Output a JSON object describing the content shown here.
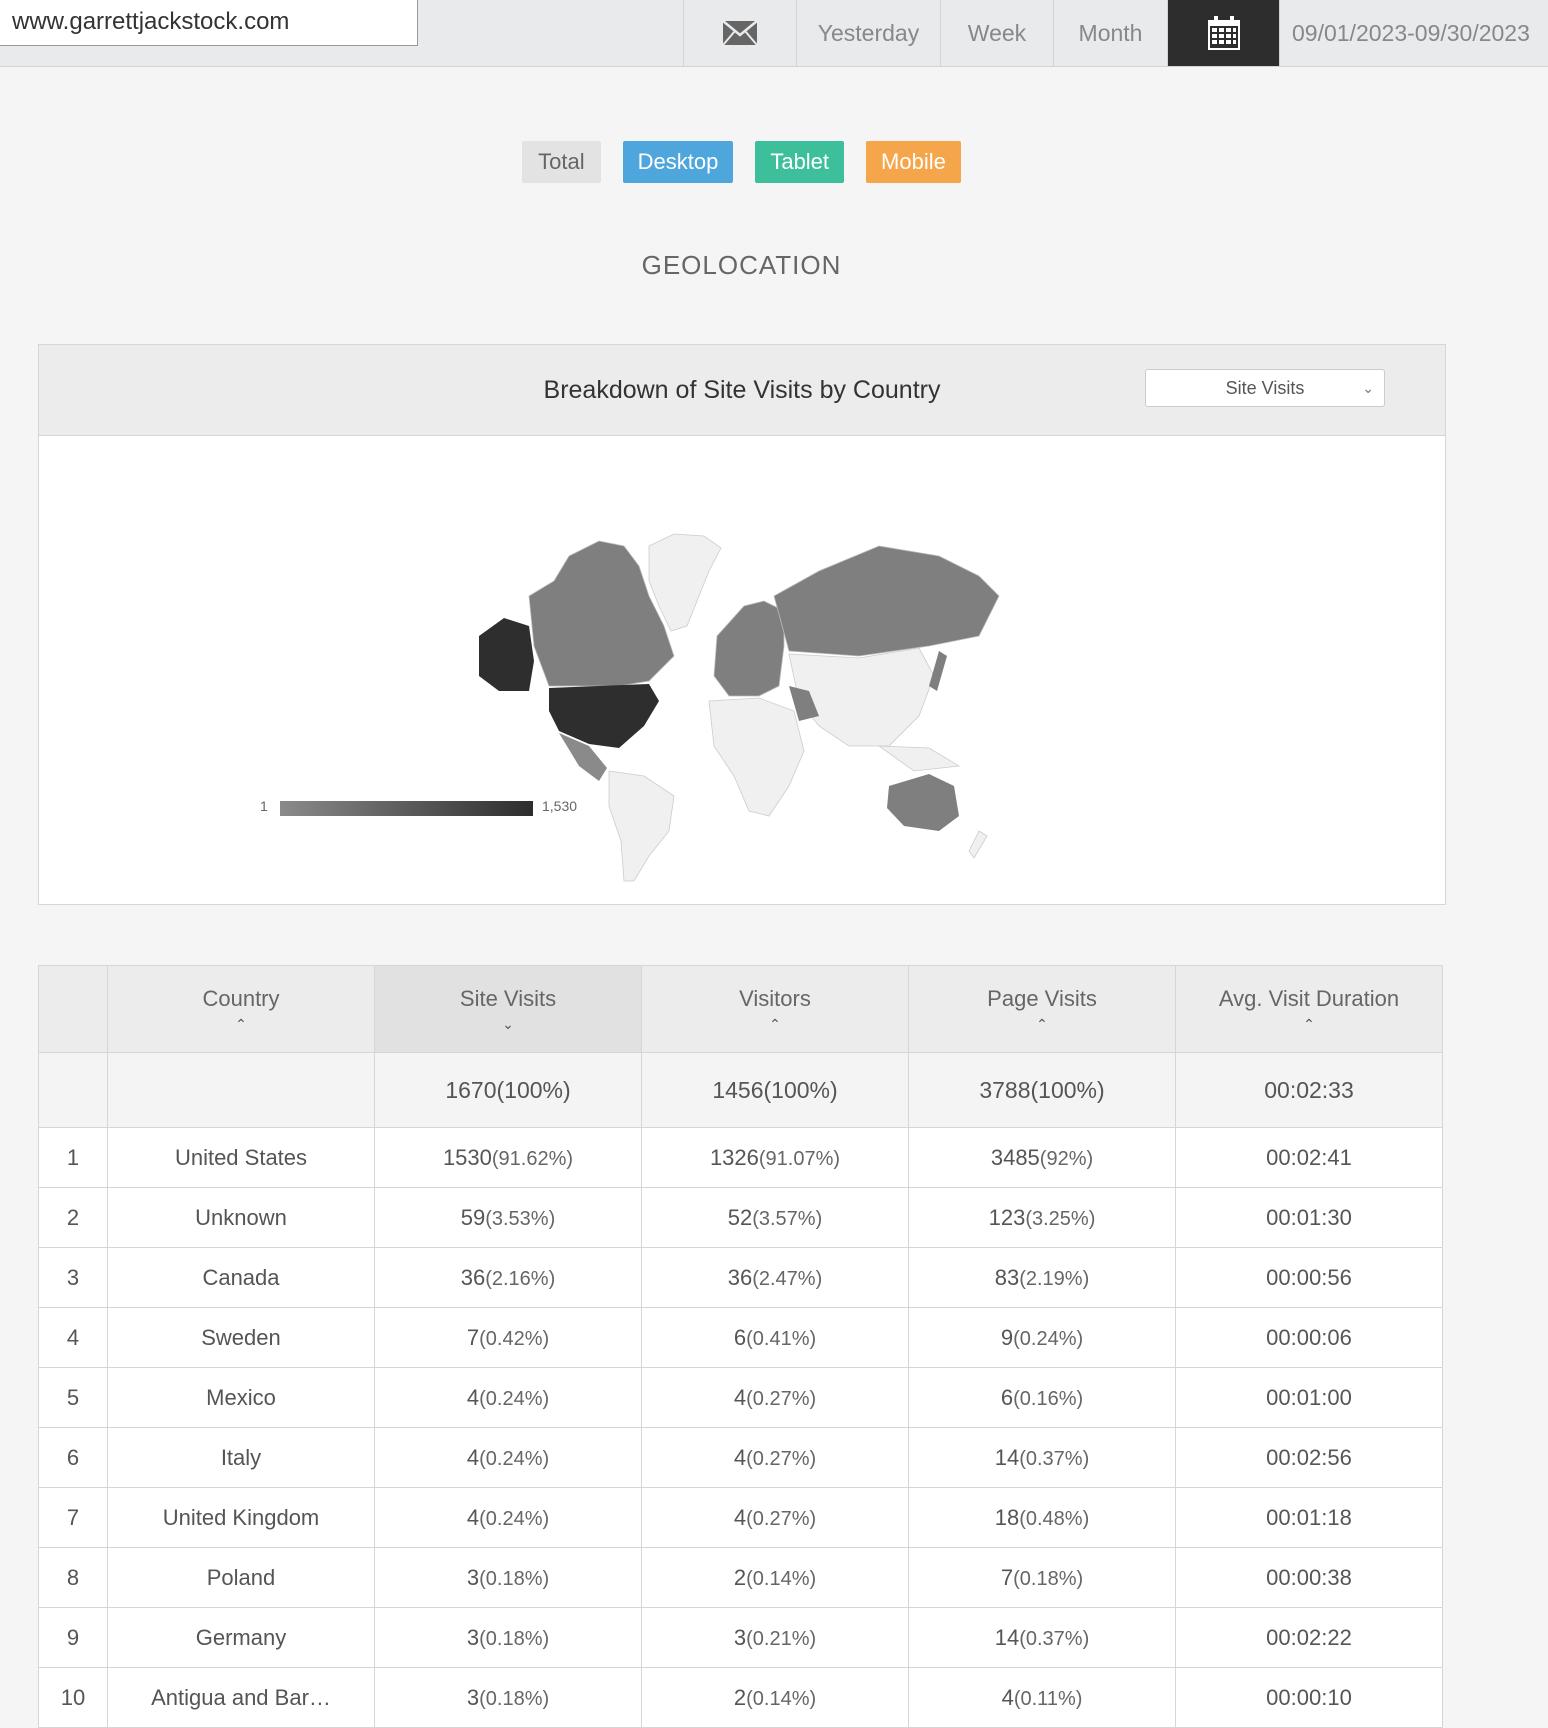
{
  "header": {
    "site": "www.garrettjackstock.com",
    "icons": {
      "mail": "mail-icon",
      "calendar": "calendar-icon"
    },
    "periods": [
      "Yesterday",
      "Week",
      "Month"
    ],
    "date_range": "09/01/2023-09/30/2023"
  },
  "filters": {
    "total": "Total",
    "desktop": "Desktop",
    "tablet": "Tablet",
    "mobile": "Mobile",
    "colors": {
      "desktop": "#4ea6dc",
      "tablet": "#3dbf9c",
      "mobile": "#f5a64a"
    }
  },
  "section_title": "GEOLOCATION",
  "map": {
    "title": "Breakdown of Site Visits by Country",
    "metric_selected": "Site Visits",
    "legend_min": "1",
    "legend_max": "1,530"
  },
  "table": {
    "columns": {
      "country": "Country",
      "site_visits": "Site Visits",
      "visitors": "Visitors",
      "page_visits": "Page Visits",
      "duration": "Avg. Visit Duration"
    },
    "totals": {
      "site_visits": "1670(100%)",
      "visitors": "1456(100%)",
      "page_visits": "3788(100%)",
      "duration": "00:02:33"
    },
    "rows": [
      {
        "rank": "1",
        "country": "United States",
        "sv": "1530",
        "sv_pct": "(91.62%)",
        "vi": "1326",
        "vi_pct": "(91.07%)",
        "pv": "3485",
        "pv_pct": "(92%)",
        "dur": "00:02:41"
      },
      {
        "rank": "2",
        "country": "Unknown",
        "sv": "59",
        "sv_pct": "(3.53%)",
        "vi": "52",
        "vi_pct": "(3.57%)",
        "pv": "123",
        "pv_pct": "(3.25%)",
        "dur": "00:01:30"
      },
      {
        "rank": "3",
        "country": "Canada",
        "sv": "36",
        "sv_pct": "(2.16%)",
        "vi": "36",
        "vi_pct": "(2.47%)",
        "pv": "83",
        "pv_pct": "(2.19%)",
        "dur": "00:00:56"
      },
      {
        "rank": "4",
        "country": "Sweden",
        "sv": "7",
        "sv_pct": "(0.42%)",
        "vi": "6",
        "vi_pct": "(0.41%)",
        "pv": "9",
        "pv_pct": "(0.24%)",
        "dur": "00:00:06"
      },
      {
        "rank": "5",
        "country": "Mexico",
        "sv": "4",
        "sv_pct": "(0.24%)",
        "vi": "4",
        "vi_pct": "(0.27%)",
        "pv": "6",
        "pv_pct": "(0.16%)",
        "dur": "00:01:00"
      },
      {
        "rank": "6",
        "country": "Italy",
        "sv": "4",
        "sv_pct": "(0.24%)",
        "vi": "4",
        "vi_pct": "(0.27%)",
        "pv": "14",
        "pv_pct": "(0.37%)",
        "dur": "00:02:56"
      },
      {
        "rank": "7",
        "country": "United Kingdom",
        "sv": "4",
        "sv_pct": "(0.24%)",
        "vi": "4",
        "vi_pct": "(0.27%)",
        "pv": "18",
        "pv_pct": "(0.48%)",
        "dur": "00:01:18"
      },
      {
        "rank": "8",
        "country": "Poland",
        "sv": "3",
        "sv_pct": "(0.18%)",
        "vi": "2",
        "vi_pct": "(0.14%)",
        "pv": "7",
        "pv_pct": "(0.18%)",
        "dur": "00:00:38"
      },
      {
        "rank": "9",
        "country": "Germany",
        "sv": "3",
        "sv_pct": "(0.18%)",
        "vi": "3",
        "vi_pct": "(0.21%)",
        "pv": "14",
        "pv_pct": "(0.37%)",
        "dur": "00:02:22"
      },
      {
        "rank": "10",
        "country": "Antigua and Bar…",
        "sv": "3",
        "sv_pct": "(0.18%)",
        "vi": "2",
        "vi_pct": "(0.14%)",
        "pv": "4",
        "pv_pct": "(0.11%)",
        "dur": "00:00:10"
      }
    ]
  }
}
